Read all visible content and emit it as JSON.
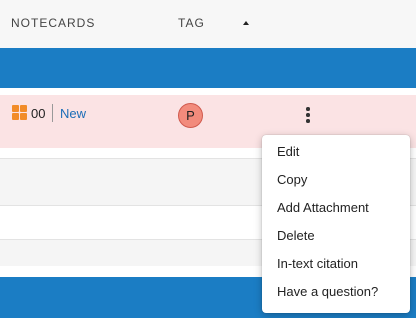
{
  "header": {
    "col_notecards": "NOTECARDS",
    "col_tag": "TAG",
    "sort_icon": "sort-ascending-triangle"
  },
  "row": {
    "icon": "grid-icon",
    "number": "00",
    "link": "New",
    "tag_initial": "P",
    "more_icon": "kebab-vertical-icon"
  },
  "menu": {
    "items": [
      "Edit",
      "Copy",
      "Add Attachment",
      "Delete",
      "In-text citation",
      "Have a question?"
    ]
  },
  "colors": {
    "accent_blue": "#1b7dc4",
    "row_highlight": "#fbe3e4",
    "grid_icon": "#f28c28",
    "tag_avatar": "#f28b7c",
    "link": "#1b6db7"
  }
}
